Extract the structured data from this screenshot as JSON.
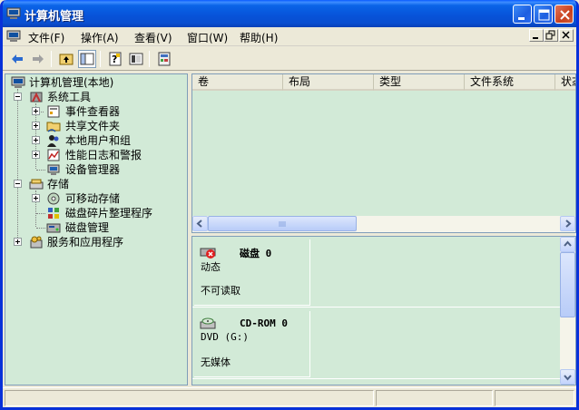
{
  "window": {
    "title": "计算机管理",
    "icon": "computer-management-icon"
  },
  "menu": {
    "items": [
      {
        "label": "文件(F)"
      },
      {
        "label": "操作(A)"
      },
      {
        "label": "查看(V)"
      },
      {
        "label": "窗口(W)"
      },
      {
        "label": "帮助(H)"
      }
    ]
  },
  "toolbar": {
    "buttons": [
      "back-arrow-icon",
      "forward-arrow-icon",
      "up-folder-icon",
      "show-hide-tree-icon",
      "properties-icon",
      "export-list-icon",
      "help-icon"
    ]
  },
  "tree": {
    "root": "计算机管理(本地)",
    "items": [
      {
        "label": "系统工具"
      },
      {
        "label": "事件查看器"
      },
      {
        "label": "共享文件夹"
      },
      {
        "label": "本地用户和组"
      },
      {
        "label": "性能日志和警报"
      },
      {
        "label": "设备管理器"
      },
      {
        "label": "存储"
      },
      {
        "label": "可移动存储"
      },
      {
        "label": "磁盘碎片整理程序"
      },
      {
        "label": "磁盘管理"
      },
      {
        "label": "服务和应用程序"
      }
    ]
  },
  "volume_list": {
    "columns": [
      "卷",
      "布局",
      "类型",
      "文件系统",
      "状态"
    ]
  },
  "disks": [
    {
      "name": "磁盘 0",
      "type": "动态",
      "status": "不可读取"
    },
    {
      "name": "CD-ROM 0",
      "type": "DVD (G:)",
      "status": "无媒体"
    }
  ],
  "colors": {
    "titlebar": "#0a5bd8",
    "panel_bg": "#d2ead7",
    "chrome": "#ece9d8"
  }
}
